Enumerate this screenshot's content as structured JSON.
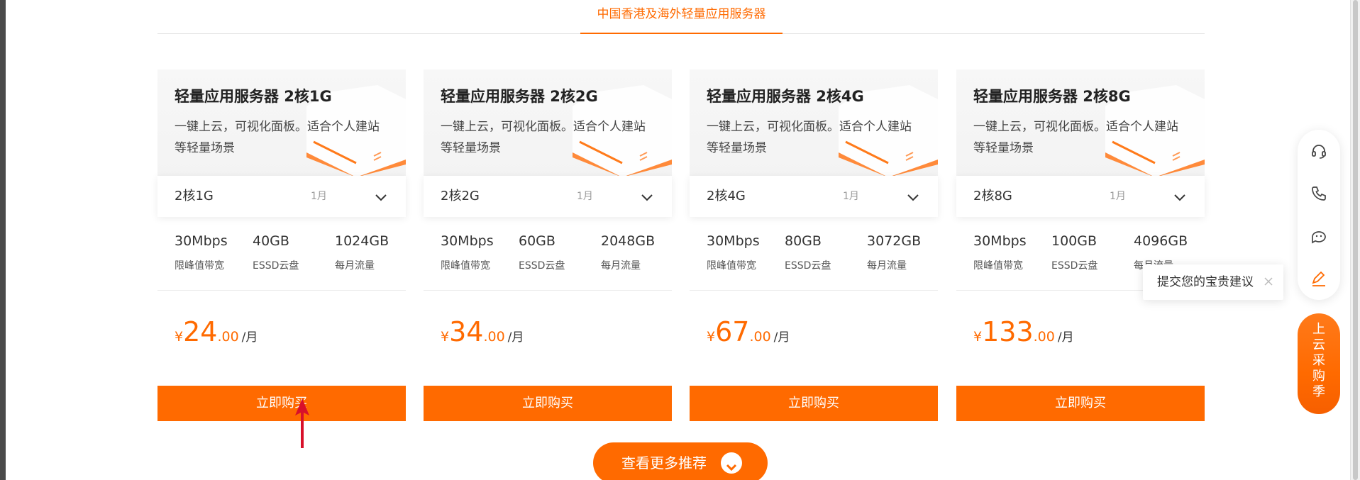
{
  "tab": {
    "label": "中国香港及海外轻量应用服务器"
  },
  "cards": [
    {
      "title": "轻量应用服务器 2核1G",
      "desc": "一键上云，可视化面板。适合个人建站等轻量场景",
      "spec": "2核1G",
      "duration": "1月",
      "stats": [
        {
          "value": "30Mbps",
          "label": "限峰值带宽"
        },
        {
          "value": "40GB",
          "label": "ESSD云盘"
        },
        {
          "value": "1024GB",
          "label": "每月流量"
        }
      ],
      "price": {
        "currency": "¥",
        "int": "24",
        "dec": ".00",
        "unit": "/月"
      },
      "buy": "立即购买"
    },
    {
      "title": "轻量应用服务器 2核2G",
      "desc": "一键上云，可视化面板。适合个人建站等轻量场景",
      "spec": "2核2G",
      "duration": "1月",
      "stats": [
        {
          "value": "30Mbps",
          "label": "限峰值带宽"
        },
        {
          "value": "60GB",
          "label": "ESSD云盘"
        },
        {
          "value": "2048GB",
          "label": "每月流量"
        }
      ],
      "price": {
        "currency": "¥",
        "int": "34",
        "dec": ".00",
        "unit": "/月"
      },
      "buy": "立即购买"
    },
    {
      "title": "轻量应用服务器 2核4G",
      "desc": "一键上云，可视化面板。适合个人建站等轻量场景",
      "spec": "2核4G",
      "duration": "1月",
      "stats": [
        {
          "value": "30Mbps",
          "label": "限峰值带宽"
        },
        {
          "value": "80GB",
          "label": "ESSD云盘"
        },
        {
          "value": "3072GB",
          "label": "每月流量"
        }
      ],
      "price": {
        "currency": "¥",
        "int": "67",
        "dec": ".00",
        "unit": "/月"
      },
      "buy": "立即购买"
    },
    {
      "title": "轻量应用服务器 2核8G",
      "desc": "一键上云，可视化面板。适合个人建站等轻量场景",
      "spec": "2核8G",
      "duration": "1月",
      "stats": [
        {
          "value": "30Mbps",
          "label": "限峰值带宽"
        },
        {
          "value": "100GB",
          "label": "ESSD云盘"
        },
        {
          "value": "4096GB",
          "label": "每月流量"
        }
      ],
      "price": {
        "currency": "¥",
        "int": "133",
        "dec": ".00",
        "unit": "/月"
      },
      "buy": "立即购买"
    }
  ],
  "more_button": {
    "label": "查看更多推荐"
  },
  "side_toolbar": {
    "icons": [
      "headset-icon",
      "phone-icon",
      "chat-bot-icon",
      "edit-icon"
    ],
    "tooltip": "提交您的宝贵建议"
  },
  "promo": {
    "chars": [
      "上",
      "云",
      "采",
      "购",
      "季"
    ]
  },
  "colors": {
    "accent": "#ff6a00"
  }
}
